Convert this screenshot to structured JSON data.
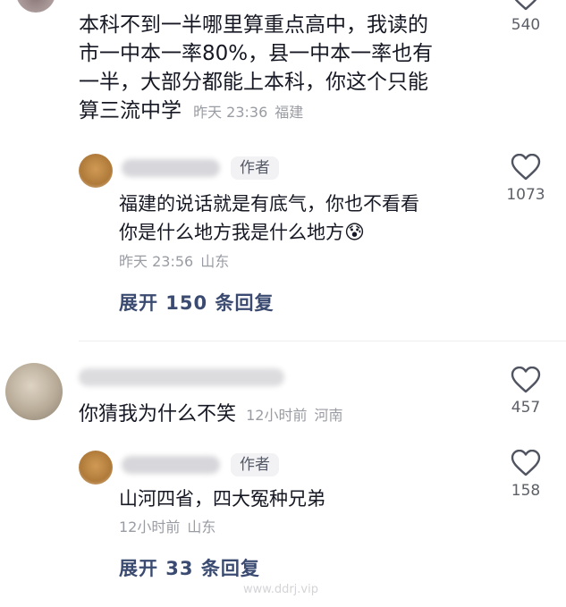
{
  "comment1": {
    "lines": [
      "本科不到一半哪里算重点高中，我读的",
      "市一中本一率80%，县一中本一率也有",
      "一半，大部分都能上本科，你这个只能",
      "算三流中学"
    ],
    "time": "昨天 23:36",
    "location": "福建",
    "likes": "540"
  },
  "reply1": {
    "author_tag": "作者",
    "lines": [
      "福建的说话就是有底气，你也不看看",
      "你是什么地方我是什么地方"
    ],
    "emoji": "😰",
    "time": "昨天 23:56",
    "location": "山东",
    "likes": "1073",
    "expand_label": "展开 150 条回复"
  },
  "comment2": {
    "text": "你猜我为什么不笑",
    "time": "12小时前",
    "location": "河南",
    "likes": "457"
  },
  "reply2": {
    "author_tag": "作者",
    "text": "山河四省，四大冤种兄弟",
    "time": "12小时前",
    "location": "山东",
    "likes": "158",
    "expand_label": "展开 33 条回复"
  },
  "watermark": "www.ddrj.vip",
  "colors": {
    "text": "#161823",
    "meta": "#9a9ca3",
    "expand": "#3a4a70",
    "tag_bg": "#f2f2f4"
  }
}
